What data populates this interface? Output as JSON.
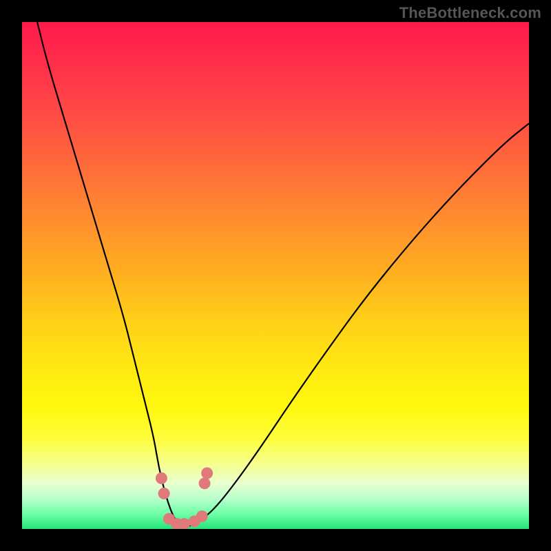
{
  "watermark": "TheBottleneck.com",
  "colors": {
    "frame": "#000000",
    "gradient_top": "#ff1a4d",
    "gradient_bottom": "#23e47a",
    "curve": "#000000",
    "dots": "#e07a7a"
  },
  "chart_data": {
    "type": "line",
    "title": "",
    "xlabel": "",
    "ylabel": "",
    "xlim": [
      0,
      100
    ],
    "ylim": [
      0,
      100
    ],
    "background": "vertical rainbow gradient (red top → green bottom)",
    "series": [
      {
        "name": "bottleneck-curve",
        "x": [
          3,
          5,
          8,
          11,
          14,
          17,
          20,
          22,
          24,
          26,
          27,
          28.5,
          30,
          31.5,
          33,
          35,
          38,
          42,
          47,
          53,
          60,
          68,
          77,
          86,
          95,
          100
        ],
        "y": [
          100,
          92,
          82,
          72,
          62,
          52,
          42,
          34,
          26,
          18,
          12,
          6,
          2,
          0.5,
          0.5,
          1.5,
          4,
          9,
          16,
          25,
          35,
          46,
          57,
          67,
          76,
          80
        ]
      }
    ],
    "markers": [
      {
        "name": "left-cluster",
        "x": 27.5,
        "y": 10
      },
      {
        "name": "left-cluster",
        "x": 28.0,
        "y": 7
      },
      {
        "name": "bottom",
        "x": 29.0,
        "y": 2
      },
      {
        "name": "bottom",
        "x": 30.5,
        "y": 1
      },
      {
        "name": "bottom",
        "x": 32.0,
        "y": 1
      },
      {
        "name": "bottom",
        "x": 34.0,
        "y": 1.5
      },
      {
        "name": "bottom",
        "x": 35.5,
        "y": 2.5
      },
      {
        "name": "right-cluster",
        "x": 36.0,
        "y": 9
      },
      {
        "name": "right-cluster",
        "x": 36.5,
        "y": 11
      }
    ],
    "annotations": [
      {
        "text": "TheBottleneck.com",
        "position": "top-right"
      }
    ]
  }
}
